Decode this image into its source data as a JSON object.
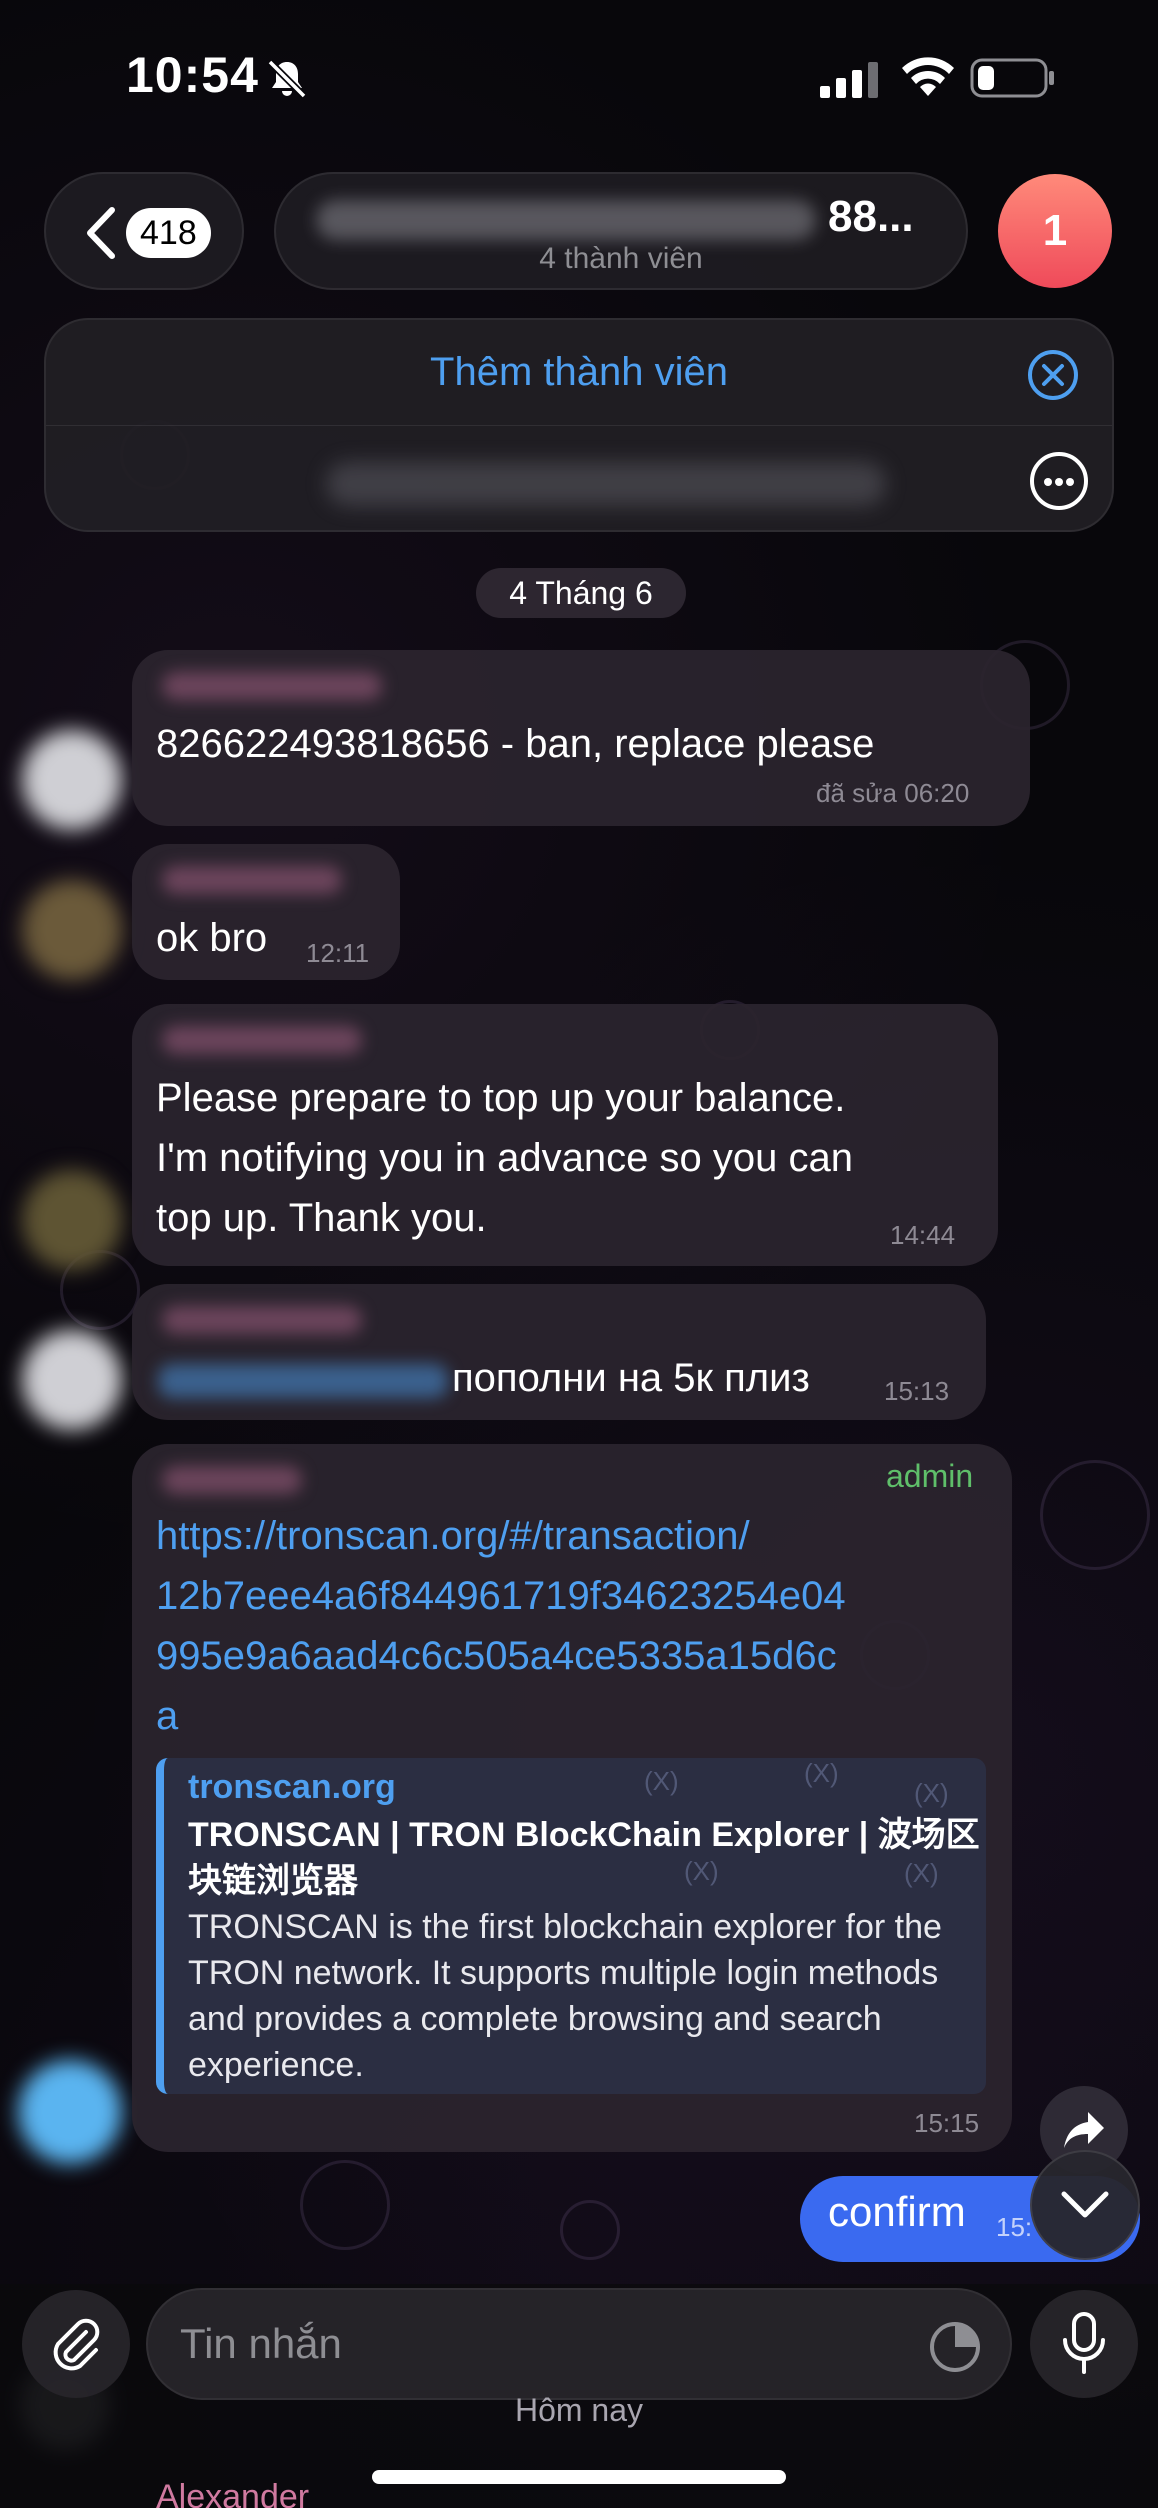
{
  "status_bar": {
    "time": "10:54"
  },
  "header": {
    "back_count": "418",
    "title_tail": "88...",
    "subtitle": "4 thành viên",
    "avatar_badge": "1"
  },
  "pinned": {
    "add_member_label": "Thêm thành viên"
  },
  "date_chip": "4 Tháng 6",
  "messages": [
    {
      "text": "826622493818656 - ban, replace please",
      "time": "đã sửa 06:20"
    },
    {
      "text": "ok bro",
      "time": "12:11"
    },
    {
      "text": "Please prepare to top up your balance.\nI'm notifying you in advance so you can\ntop up. Thank you.",
      "time": "14:44"
    },
    {
      "text": "пополни на 5к плиз",
      "time": "15:13"
    },
    {
      "badge": "admin",
      "link": "https://tronscan.org/#/transaction/\n12b7eee4a6f844961719f34623254e04\n995e9a6aad4c6c505a4ce5335a15d6c\na",
      "preview_site": "tronscan.org",
      "preview_title": "TRONSCAN | TRON BlockChain Explorer | 波场区块链浏览器",
      "preview_desc": "TRONSCAN is the first blockchain explorer for the TRON network. It supports multiple login methods and provides a complete browsing and search experience.",
      "time": "15:15"
    }
  ],
  "outgoing": {
    "text": "confirm",
    "time": "15:"
  },
  "composer": {
    "placeholder": "Tin nhắn"
  },
  "today_label": "Hôm nay",
  "peek_name": "Alexander",
  "colors": {
    "accent": "#4e9ff0",
    "outgoing_bubble": "#3a6af0",
    "admin": "#5fbf6a",
    "avatar_badge": "#ef4a5a"
  }
}
